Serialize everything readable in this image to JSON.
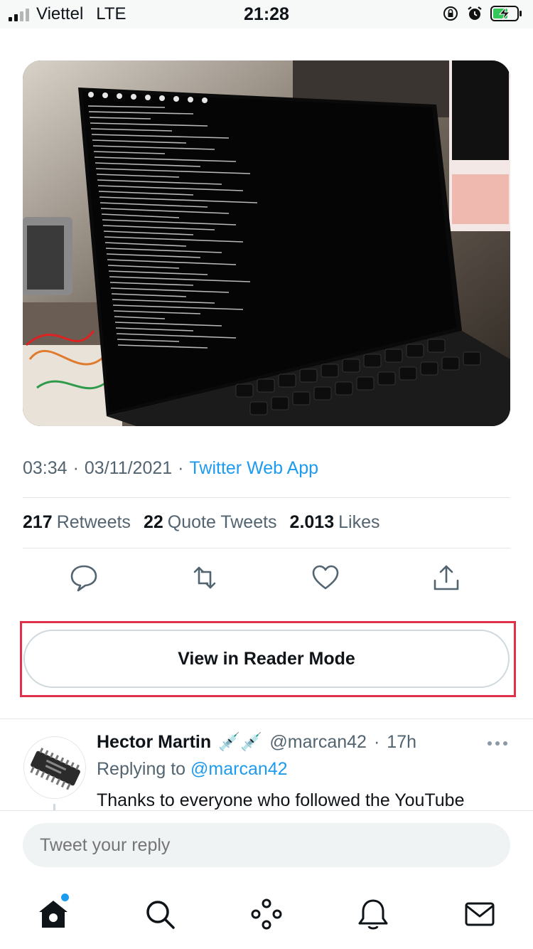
{
  "status_bar": {
    "carrier": "Viettel",
    "network": "LTE",
    "time": "21:28"
  },
  "tweet": {
    "time": "03:34",
    "date": "03/11/2021",
    "separator": "·",
    "source": "Twitter Web App",
    "stats": {
      "retweets_count": "217",
      "retweets_label": "Retweets",
      "quotes_count": "22",
      "quotes_label": "Quote Tweets",
      "likes_count": "2.013",
      "likes_label": "Likes"
    }
  },
  "reader_mode_button": "View in Reader Mode",
  "reply": {
    "name": "Hector Martin",
    "emoji": "💉💉",
    "handle": "@marcan42",
    "time_ago": "17h",
    "replying_prefix": "Replying to",
    "replying_to": "@marcan42",
    "text": "Thanks to everyone who followed the YouTube"
  },
  "composer": {
    "placeholder": "Tweet your reply"
  },
  "colors": {
    "accent": "#1d9bf0",
    "highlight_outline": "#e0314b",
    "secondary_text": "#536471"
  },
  "icons": {
    "reply": "reply-icon",
    "retweet": "retweet-icon",
    "like": "heart-icon",
    "share": "share-icon",
    "home": "home-icon",
    "search": "search-icon",
    "spaces": "spaces-icon",
    "notifications": "bell-icon",
    "messages": "mail-icon"
  }
}
